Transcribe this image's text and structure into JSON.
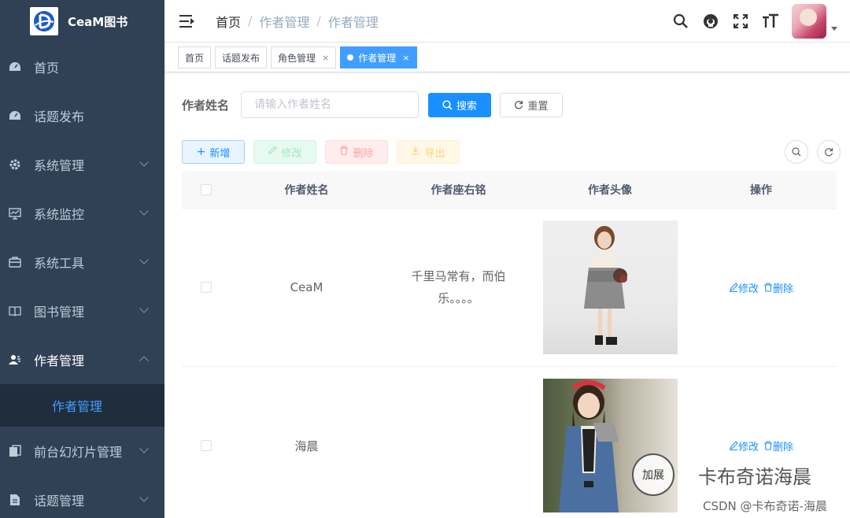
{
  "app": {
    "title": "CeaM图书"
  },
  "sidebar": {
    "items": [
      {
        "label": "首页",
        "icon": "dashboard-icon"
      },
      {
        "label": "话题发布",
        "icon": "dashboard-icon"
      },
      {
        "label": "系统管理",
        "icon": "gear-icon"
      },
      {
        "label": "系统监控",
        "icon": "monitor-icon"
      },
      {
        "label": "系统工具",
        "icon": "toolbox-icon"
      },
      {
        "label": "图书管理",
        "icon": "book-icon"
      },
      {
        "label": "作者管理",
        "icon": "user-icon"
      },
      {
        "label": "前台幻灯片管理",
        "icon": "slides-icon"
      },
      {
        "label": "话题管理",
        "icon": "document-icon"
      }
    ],
    "sub_item": "作者管理"
  },
  "breadcrumb": [
    "首页",
    "作者管理",
    "作者管理"
  ],
  "tags": [
    {
      "label": "首页"
    },
    {
      "label": "话题发布"
    },
    {
      "label": "角色管理",
      "close": "×"
    },
    {
      "label": "作者管理",
      "close": "×"
    }
  ],
  "search": {
    "label": "作者姓名",
    "placeholder": "请输入作者姓名",
    "search_btn": "搜索",
    "reset_btn": "重置"
  },
  "toolbar": {
    "add": "新增",
    "edit": "修改",
    "delete": "删除",
    "export": "导出"
  },
  "table": {
    "headers": [
      "作者姓名",
      "作者座右铭",
      "作者头像",
      "操作"
    ],
    "rows": [
      {
        "name": "CeaM",
        "motto": "千里马常有，而伯乐。。。。",
        "edit": "修改",
        "delete": "删除"
      },
      {
        "name": "海晨",
        "motto": "",
        "edit": "修改",
        "delete": "删除"
      }
    ]
  },
  "watermark": {
    "circle": "加展",
    "text": "卡布奇诺海晨",
    "sub": "CSDN @卡布奇诺-海晨"
  },
  "colors": {
    "sidebar": "#304156",
    "primary": "#1890ff",
    "active_menu": "#409eff"
  }
}
